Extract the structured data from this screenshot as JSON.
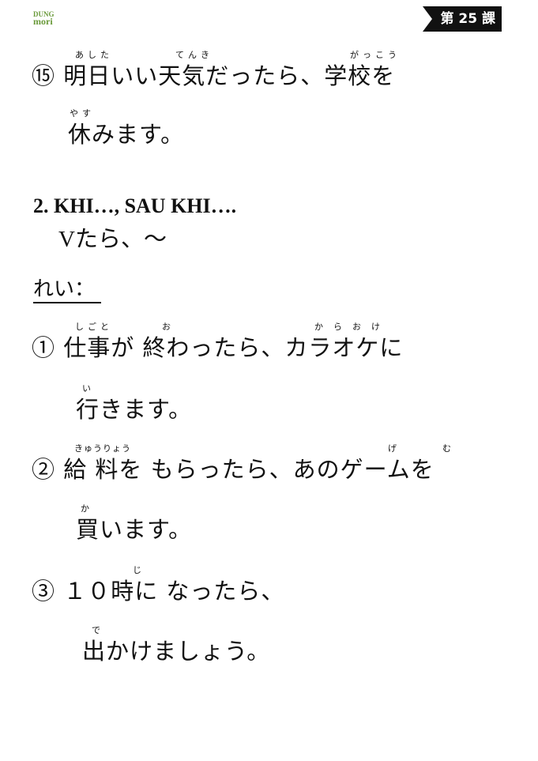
{
  "header": {
    "logo_line1": "DUNG",
    "logo_line2": "mori",
    "lesson_badge": "第 25 課"
  },
  "example15": {
    "line1": "⑮ 明日いい天気だったら、学校を",
    "line1_ruby": [
      "あした",
      "てんき",
      "がっこう"
    ],
    "line2": "休みます。",
    "line2_ruby": [
      "やす"
    ]
  },
  "section2": {
    "heading": "2. KHI…, SAU KHI….",
    "pattern": "Vたら、～"
  },
  "examples_label": "れい：",
  "examples": [
    {
      "line1": "① 仕事が 終わったら、カラオケに",
      "line1_ruby": [
        "しごと",
        "お",
        "からおけ"
      ],
      "line2": "行きます。",
      "line2_ruby": [
        "い"
      ]
    },
    {
      "line1": "② 給 料を もらったら、あのゲームを",
      "line1_ruby": [
        "きゅうりょう",
        "げ",
        "む"
      ],
      "line2": "買います。",
      "line2_ruby": [
        "か"
      ]
    },
    {
      "line1": "③ １０時に なったら、",
      "line1_ruby": [
        "じ"
      ],
      "line2": "出かけましょう。",
      "line2_ruby": [
        "で"
      ]
    }
  ]
}
